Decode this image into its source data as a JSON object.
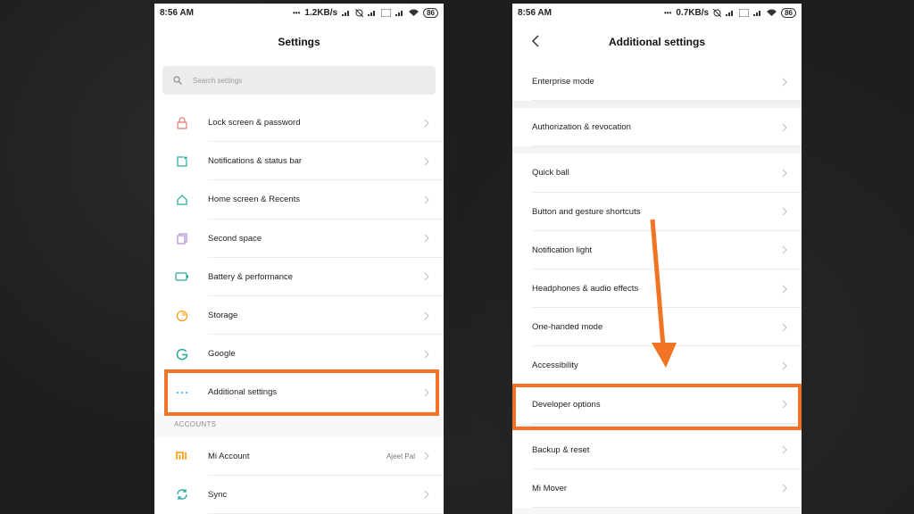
{
  "colors": {
    "accent_highlight": "#f07423",
    "icon_red": "#e57373",
    "icon_teal": "#26a69a",
    "icon_blue": "#42a5f5",
    "icon_purple": "#ab8fd6",
    "icon_orange": "#ff9800"
  },
  "left": {
    "status": {
      "time": "8:56 AM",
      "speed": "1.2KB/s",
      "battery": "86"
    },
    "title": "Settings",
    "search": {
      "placeholder": "Search settings"
    },
    "items": [
      {
        "label": "Lock screen & password",
        "icon": "lock-icon"
      },
      {
        "label": "Notifications & status bar",
        "icon": "notification-icon"
      },
      {
        "label": "Home screen & Recents",
        "icon": "home-icon"
      },
      {
        "label": "Second space",
        "icon": "second-space-icon"
      },
      {
        "label": "Battery & performance",
        "icon": "battery-icon"
      },
      {
        "label": "Storage",
        "icon": "storage-pie-icon"
      },
      {
        "label": "Google",
        "icon": "google-icon"
      },
      {
        "label": "Additional settings",
        "icon": "more-dots-icon"
      }
    ],
    "accounts_header": "ACCOUNTS",
    "accounts": [
      {
        "label": "Mi Account",
        "value": "Ajeet Pal",
        "icon": "mi-logo-icon"
      },
      {
        "label": "Sync",
        "icon": "sync-icon"
      }
    ]
  },
  "right": {
    "status": {
      "time": "8:56 AM",
      "speed": "0.7KB/s",
      "battery": "86"
    },
    "title": "Additional settings",
    "group1": [
      {
        "label": "Enterprise mode"
      }
    ],
    "group2": [
      {
        "label": "Authorization & revocation"
      }
    ],
    "group3": [
      {
        "label": "Quick ball"
      },
      {
        "label": "Button and gesture shortcuts"
      },
      {
        "label": "Notification light"
      },
      {
        "label": "Headphones & audio effects"
      },
      {
        "label": "One-handed mode"
      },
      {
        "label": "Accessibility"
      },
      {
        "label": "Developer options"
      },
      {
        "label": "Backup & reset"
      },
      {
        "label": "Mi Mover"
      }
    ]
  }
}
